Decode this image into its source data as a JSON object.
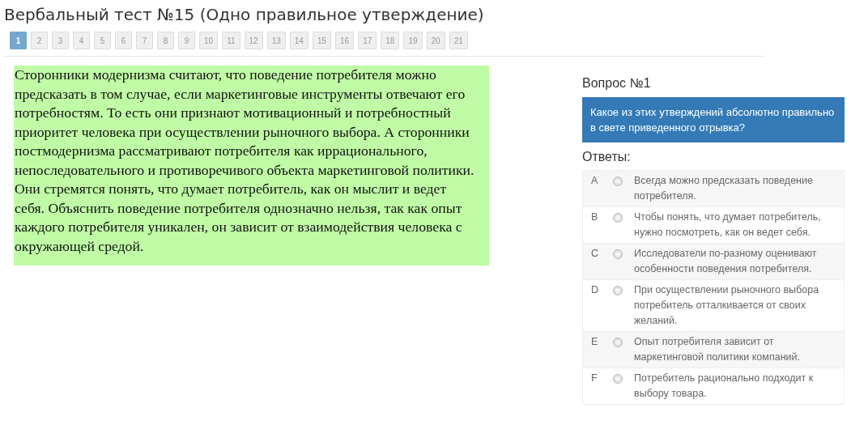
{
  "title": "Вербальный тест №15 (Одно правильное утверждение)",
  "pages": [
    {
      "label": "1",
      "selected": true
    },
    {
      "label": "2",
      "selected": false
    },
    {
      "label": "3",
      "selected": false
    },
    {
      "label": "4",
      "selected": false
    },
    {
      "label": "5",
      "selected": false
    },
    {
      "label": "6",
      "selected": false
    },
    {
      "label": "7",
      "selected": false
    },
    {
      "label": "8",
      "selected": false
    },
    {
      "label": "9",
      "selected": false
    },
    {
      "label": "10",
      "selected": false
    },
    {
      "label": "11",
      "selected": false
    },
    {
      "label": "12",
      "selected": false
    },
    {
      "label": "13",
      "selected": false
    },
    {
      "label": "14",
      "selected": false
    },
    {
      "label": "15",
      "selected": false
    },
    {
      "label": "16",
      "selected": false
    },
    {
      "label": "17",
      "selected": false
    },
    {
      "label": "18",
      "selected": false
    },
    {
      "label": "19",
      "selected": false
    },
    {
      "label": "20",
      "selected": false
    },
    {
      "label": "21",
      "selected": false
    }
  ],
  "passage": "Сторонники модернизма считают, что поведение потребителя можно предсказать в том случае, если маркетинговые инструменты отвечают его потребностям. То есть они признают мотивационный и потребностный приоритет человека при осуществлении рыночного выбора. А сторонники постмодернизма рассматривают потребителя как иррационального, непоследовательного и противоречивого объекта маркетинговой политики. Они стремятся понять, что думает потребитель, как он мыслит и ведет себя. Объяснить поведение потребителя однозначно нельзя, так как опыт каждого потребителя уникален, он зависит от взаимодействия человека с окружающей средой.",
  "question": {
    "heading": "Вопрос №1",
    "text": "Какое из этих утверждений абсолютно правильно в свете приведенного отрывка?"
  },
  "answers_heading": "Ответы:",
  "answers": [
    {
      "letter": "A",
      "text": "Всегда можно предсказать поведение потребителя.",
      "selected": false
    },
    {
      "letter": "B",
      "text": "Чтобы понять, что думает потребитель, нужно посмотреть, как он ведет себя.",
      "selected": false
    },
    {
      "letter": "C",
      "text": "Исследователи по-разному оценивают особенности поведения потребителя.",
      "selected": false
    },
    {
      "letter": "D",
      "text": "При осуществлении рыночного выбора потребитель отталкивается от своих желаний.",
      "selected": false
    },
    {
      "letter": "E",
      "text": "Опыт потребителя зависит от маркетинговой политики компаний.",
      "selected": false
    },
    {
      "letter": "F",
      "text": "Потребитель рационально подходит к выбору товара.",
      "selected": false
    }
  ]
}
